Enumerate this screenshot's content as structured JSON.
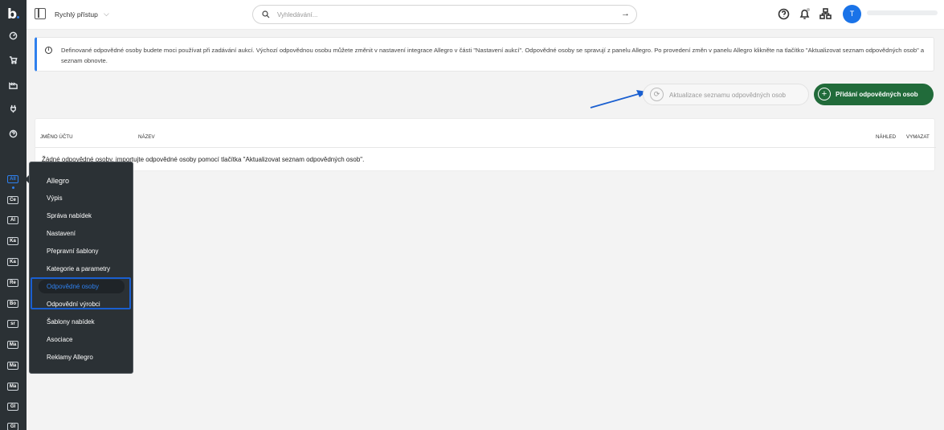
{
  "logo": {
    "text": "b"
  },
  "colors": {
    "sidebar": "#2b3135",
    "accent": "#2f80ed",
    "primary_button": "#216b3a",
    "avatar": "#1a73e8",
    "highlight": "#1a5fd0"
  },
  "sidebar": {
    "icons": [
      "dashboard-icon",
      "cart-icon",
      "warehouse-icon",
      "plug-icon",
      "help-icon"
    ],
    "channels": [
      "All",
      "Ce",
      "Al",
      "Ka",
      "Ka",
      "Re",
      "Bo",
      "sr",
      "Ma",
      "Ma",
      "Ma",
      "Gl",
      "Gl"
    ]
  },
  "topbar": {
    "quick_access": "Rychlý přístup",
    "search_placeholder": "Vyhledávání...",
    "avatar_initial": "T",
    "icons": [
      "help-icon",
      "bell-icon",
      "network-icon"
    ]
  },
  "info": {
    "text": "Definované odpovědné osoby budete moci používat při zadávání aukcí. Výchozí odpovědnou osobu můžete změnit v nastavení integrace Allegro v části \"Nastavení aukcí\". Odpovědné osoby se spravují z panelu Allegro. Po provedení změn v panelu Allegro klikněte na tlačítko \"Aktualizovat seznam odpovědných osob\" a seznam obnovte."
  },
  "actions": {
    "refresh_label": "Aktualizace seznamu odpovědných osob",
    "add_label": "Přidání odpovědných osob"
  },
  "table": {
    "headers": {
      "account": "JMÉNO ÚČTU",
      "name": "NÁZEV",
      "preview": "NÁHLED",
      "delete": "VYMAZAT"
    },
    "empty_text": "Žádné odpovědné osoby, importujte odpovědné osoby pomocí tlačítka \"Aktualizovat seznam odpovědných osob\"."
  },
  "dropdown": {
    "title": "Allegro",
    "items": [
      "Výpis",
      "Správa nabídek",
      "Nastavení",
      "Přepravní šablony",
      "Kategorie a parametry",
      "Odpovědné osoby",
      "Odpovědní výrobci",
      "Šablony nabídek",
      "Asociace",
      "Reklamy Allegro"
    ],
    "selected_index": 5
  }
}
